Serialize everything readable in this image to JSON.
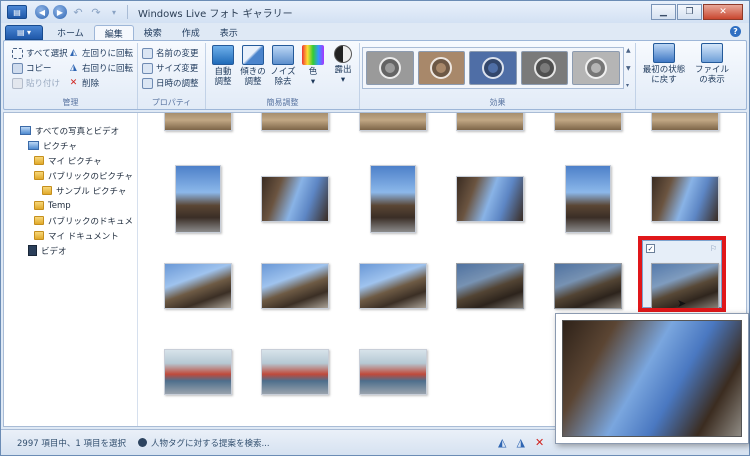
{
  "window": {
    "title": "Windows Live フォト ギャラリー"
  },
  "tabs": [
    {
      "label": "ホーム"
    },
    {
      "label": "編集"
    },
    {
      "label": "検索"
    },
    {
      "label": "作成"
    },
    {
      "label": "表示"
    }
  ],
  "ribbon": {
    "manage": {
      "label": "管理",
      "select_all": "すべて選択",
      "copy": "コピー",
      "paste": "貼り付け",
      "rotate_left": "左回りに回転",
      "rotate_right": "右回りに回転",
      "delete": "削除"
    },
    "properties": {
      "label": "プロパティ",
      "rename": "名前の変更",
      "resize": "サイズ変更",
      "date_adjust": "日時の調整"
    },
    "quick_fix": {
      "label": "簡易調整",
      "auto_adjust_1": "自動",
      "auto_adjust_2": "調整",
      "straighten_1": "傾きの",
      "straighten_2": "調整",
      "noise_1": "ノイズ",
      "noise_2": "除去",
      "color": "色",
      "exposure": "露出"
    },
    "effects": {
      "label": "効果"
    },
    "revert_1": "最初の状態",
    "revert_2": "に戻す",
    "show_file_1": "ファイル",
    "show_file_2": "の表示"
  },
  "nav": [
    {
      "label": "すべての写真とビデオ",
      "icon": "library-icon",
      "indent": 0
    },
    {
      "label": "ピクチャ",
      "icon": "pictures-icon",
      "indent": 1
    },
    {
      "label": "マイ ピクチャ",
      "icon": "folder-icon",
      "indent": 2
    },
    {
      "label": "パブリックのピクチャ",
      "icon": "folder-icon",
      "indent": 2
    },
    {
      "label": "サンプル ピクチャ",
      "icon": "folder-icon",
      "indent": 3
    },
    {
      "label": "Temp",
      "icon": "folder-icon",
      "indent": 2
    },
    {
      "label": "パブリックのドキュメ",
      "icon": "folder-icon",
      "indent": 2
    },
    {
      "label": "マイ ドキュメント",
      "icon": "folder-icon",
      "indent": 2
    },
    {
      "label": "ビデオ",
      "icon": "video-icon",
      "indent": 1
    }
  ],
  "status": {
    "count": "2997 項目中、1 項目を選択",
    "tag_suggest": "人物タグに対する提案を検索..."
  },
  "colors": {
    "selection_outline": "#e0171a",
    "accent": "#1f58a9"
  }
}
